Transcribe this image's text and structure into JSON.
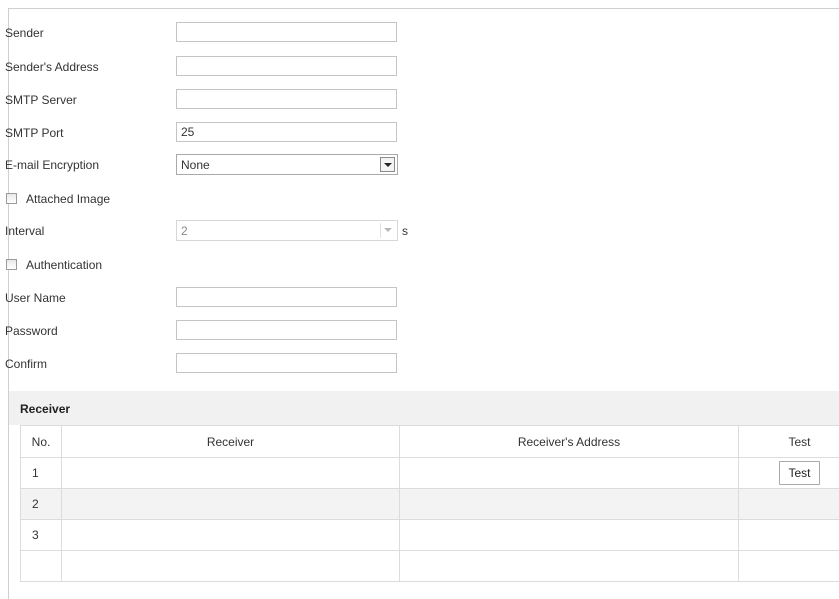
{
  "form": {
    "sender": {
      "label": "Sender",
      "value": ""
    },
    "sender_address": {
      "label": "Sender's Address",
      "value": ""
    },
    "smtp_server": {
      "label": "SMTP Server",
      "value": ""
    },
    "smtp_port": {
      "label": "SMTP Port",
      "value": "25"
    },
    "email_encryption": {
      "label": "E-mail Encryption",
      "selected": "None"
    },
    "attached_image": {
      "label": "Attached Image",
      "checked": false
    },
    "interval": {
      "label": "Interval",
      "selected": "2",
      "unit": "s"
    },
    "authentication": {
      "label": "Authentication",
      "checked": false
    },
    "user_name": {
      "label": "User Name",
      "value": ""
    },
    "password": {
      "label": "Password",
      "value": ""
    },
    "confirm": {
      "label": "Confirm",
      "value": ""
    }
  },
  "receiver": {
    "section_title": "Receiver",
    "columns": [
      "No.",
      "Receiver",
      "Receiver's Address",
      "Test"
    ],
    "rows": [
      {
        "no": "1",
        "receiver": "",
        "address": "",
        "test_label": "Test"
      },
      {
        "no": "2",
        "receiver": "",
        "address": ""
      },
      {
        "no": "3",
        "receiver": "",
        "address": ""
      },
      {
        "no": "",
        "receiver": "",
        "address": ""
      }
    ]
  }
}
